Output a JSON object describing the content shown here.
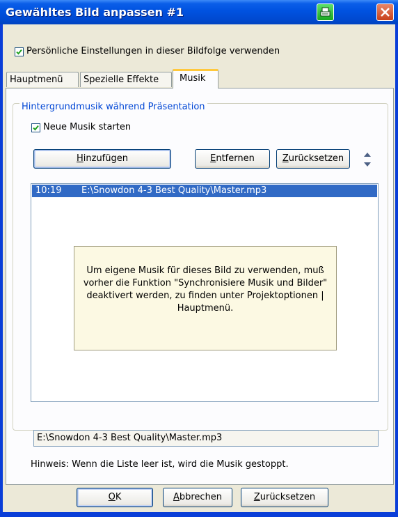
{
  "window": {
    "title": "Gewähltes Bild anpassen #1",
    "accent": "#0a5ee8"
  },
  "settings": {
    "use_personal_label": "Persönliche Einstellungen in dieser Bildfolge verwenden",
    "use_personal_checked": true
  },
  "tabs": [
    {
      "label": "Hauptmenü",
      "active": false
    },
    {
      "label": "Spezielle Effekte",
      "active": false
    },
    {
      "label": "Musik",
      "active": true
    }
  ],
  "music": {
    "group_title": "Hintergrundmusik während Präsentation",
    "start_new_label": "Neue Musik starten",
    "start_new_checked": true,
    "buttons": {
      "add_prefix": "",
      "add_mnemonic": "H",
      "add_rest": "inzufügen",
      "remove_mnemonic": "E",
      "remove_rest": "ntfernen",
      "reset_mnemonic": "Z",
      "reset_rest": "urücksetzen"
    },
    "list_rows": [
      {
        "time": "10:19",
        "path": "E:\\Snowdon 4-3 Best Quality\\Master.mp3"
      }
    ],
    "info_text": "Um eigene Musik für dieses Bild zu verwenden, muß vorher die Funktion \"Synchronisiere Musik und Bilder\" deaktivert werden, zu finden unter Projektoptionen | Hauptmenü.",
    "selected_path": "E:\\Snowdon 4-3 Best Quality\\Master.mp3",
    "hint": "Hinweis: Wenn die Liste leer ist, wird die Musik gestoppt."
  },
  "footer": {
    "ok_mnemonic": "O",
    "ok_rest": "K",
    "cancel_mnemonic": "A",
    "cancel_rest": "bbrechen",
    "reset_mnemonic": "Z",
    "reset_rest": "urücksetzen"
  },
  "icons": {
    "print": "printer-icon",
    "close": "close-icon",
    "spin_up": "arrow-up-icon",
    "spin_down": "arrow-down-icon",
    "check": "checkmark-icon"
  }
}
